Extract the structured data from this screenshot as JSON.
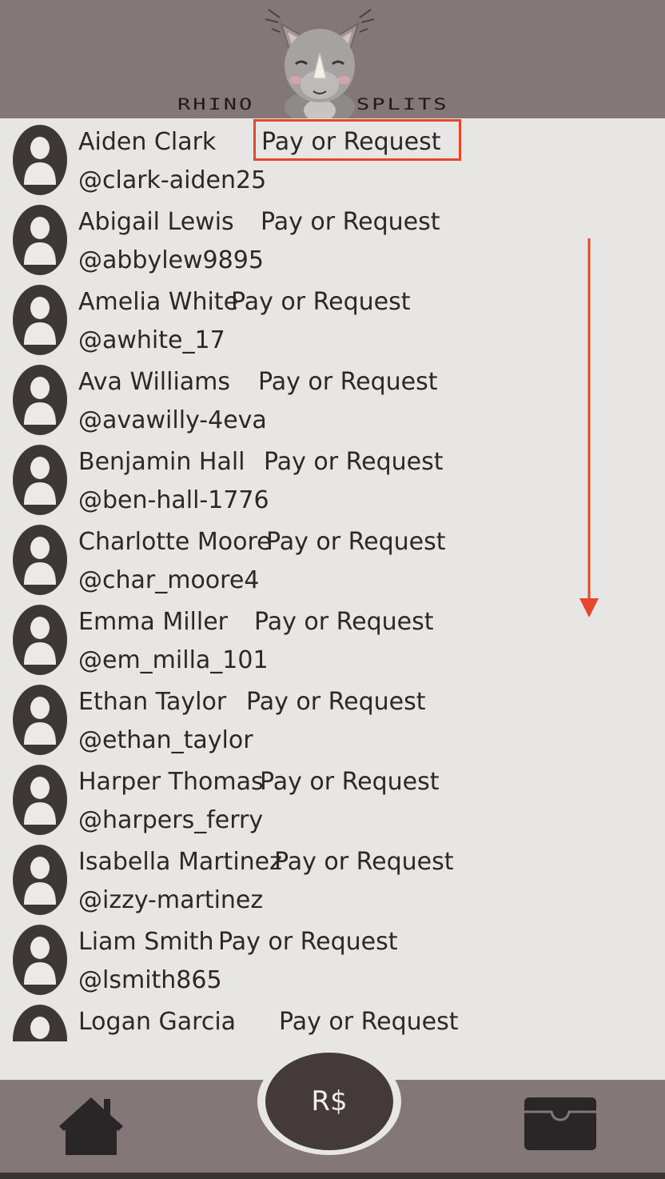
{
  "app": {
    "logo_left": "RHINO",
    "logo_right": "SPLITS"
  },
  "pay_action_label": "Pay or Request",
  "contacts": [
    {
      "name": "Aiden Clark",
      "handle": "@clark-aiden25"
    },
    {
      "name": "Abigail Lewis",
      "handle": "@abbylew9895"
    },
    {
      "name": "Amelia White",
      "handle": "@awhite_17"
    },
    {
      "name": "Ava Williams",
      "handle": "@avawilly-4eva"
    },
    {
      "name": "Benjamin Hall",
      "handle": "@ben-hall-1776"
    },
    {
      "name": "Charlotte Moore",
      "handle": "@char_moore4"
    },
    {
      "name": "Emma Miller",
      "handle": "@em_milla_101"
    },
    {
      "name": "Ethan Taylor",
      "handle": "@ethan_taylor"
    },
    {
      "name": "Harper Thomas",
      "handle": "@harpers_ferry"
    },
    {
      "name": "Isabella Martinez",
      "handle": "@izzy-martinez"
    },
    {
      "name": "Liam Smith",
      "handle": "@lsmith865"
    },
    {
      "name": "Logan Garcia",
      "handle": ""
    }
  ],
  "nav": {
    "home_icon": "home-icon",
    "center_label": "R$",
    "wallet_icon": "wallet-icon"
  },
  "colors": {
    "header_bg": "#847778",
    "list_bg": "#e8e5e5",
    "highlight": "#e5472d",
    "center_button": "#453a3b"
  }
}
